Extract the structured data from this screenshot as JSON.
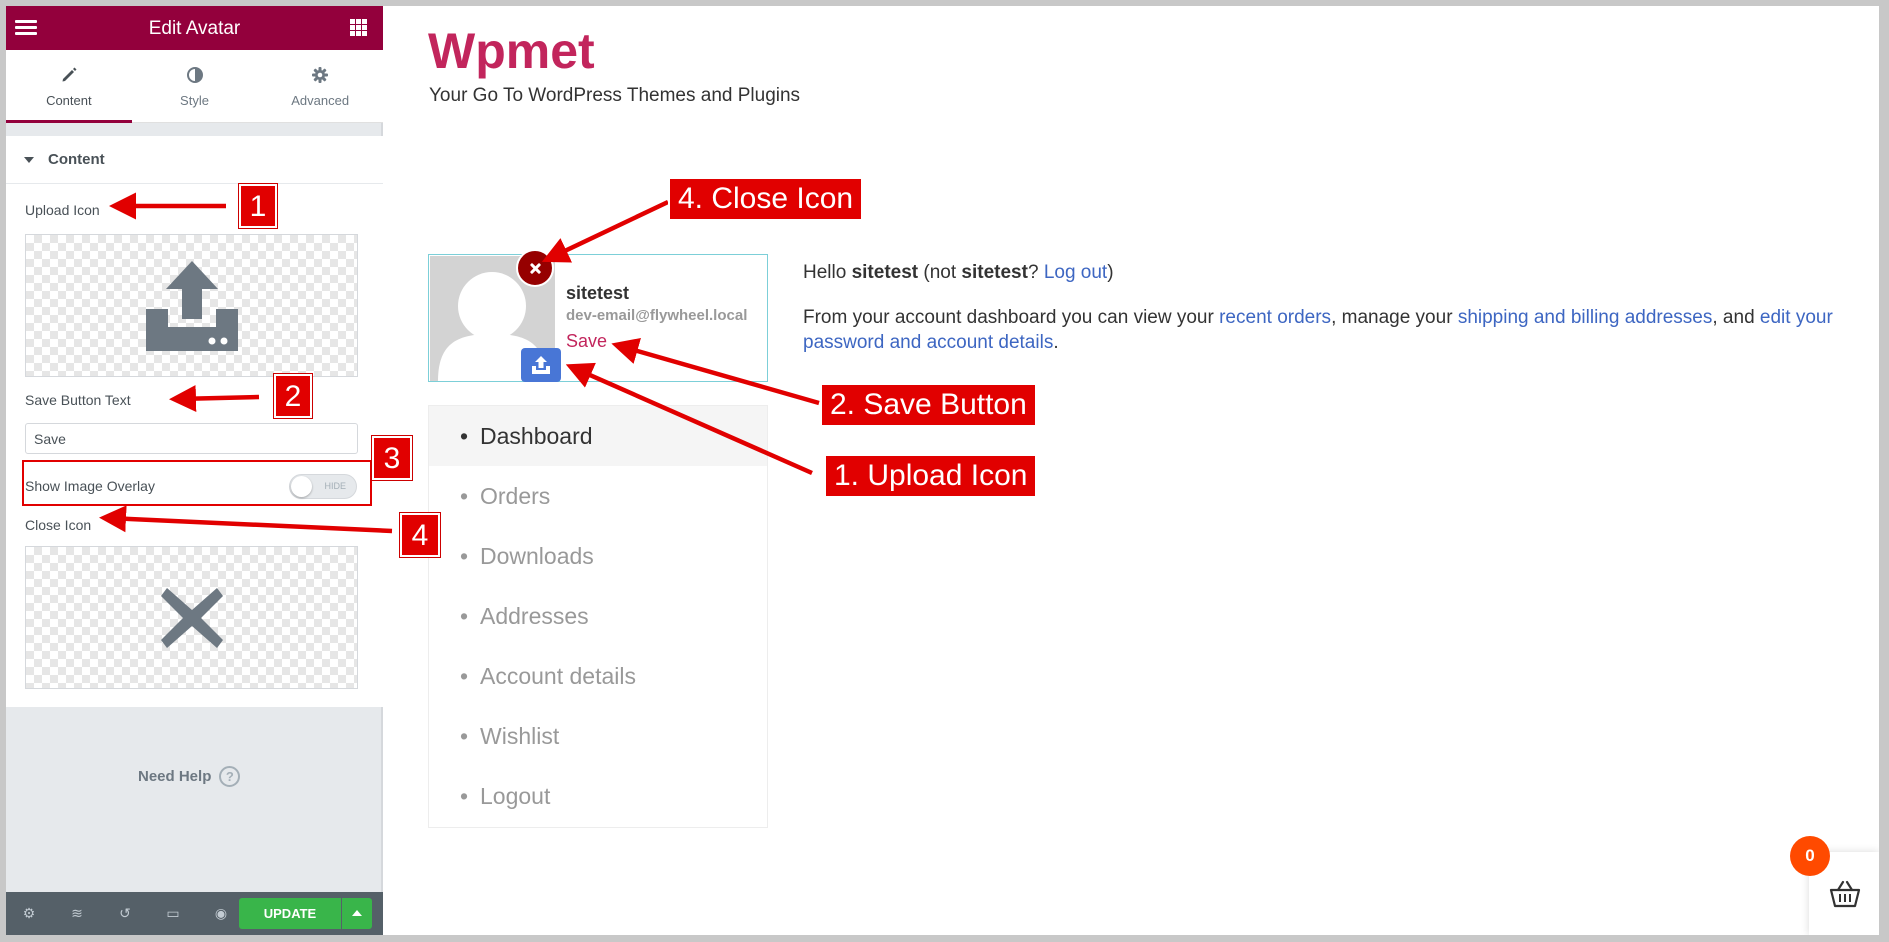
{
  "panel": {
    "title": "Edit Avatar",
    "tabs": [
      {
        "label": "Content",
        "icon": "pencil-icon"
      },
      {
        "label": "Style",
        "icon": "half-circle-icon"
      },
      {
        "label": "Advanced",
        "icon": "gear-icon"
      }
    ],
    "section_title": "Content",
    "upload_icon_label": "Upload Icon",
    "save_button_text_label": "Save Button Text",
    "save_button_text_value": "Save",
    "show_overlay_label": "Show Image Overlay",
    "overlay_toggle_text": "HIDE",
    "close_icon_label": "Close Icon",
    "need_help": "Need Help",
    "help_icon": "?",
    "update_label": "UPDATE"
  },
  "site": {
    "title": "Wpmet",
    "tagline": "Your Go To WordPress Themes and Plugins"
  },
  "avatar": {
    "username": "sitetest",
    "email": "dev-email@flywheel.local",
    "save_label": "Save"
  },
  "account_nav": [
    "Dashboard",
    "Orders",
    "Downloads",
    "Addresses",
    "Account details",
    "Wishlist",
    "Logout"
  ],
  "greeting": {
    "hello": "Hello ",
    "user": "sitetest",
    "not_open": " (not ",
    "user2": "sitetest",
    "q": "? ",
    "logout": "Log out",
    "close": ")"
  },
  "dashboard": {
    "t1": "From your account dashboard you can view your ",
    "l1": "recent orders",
    "t2": ", manage your ",
    "l2": "shipping and billing addresses",
    "t3": ", and ",
    "l3": "edit your password and account details",
    "t4": "."
  },
  "cart": {
    "count": "0"
  },
  "annotations": {
    "n1": "1",
    "n2": "2",
    "n3": "3",
    "n4": "4",
    "close_icon": "4. Close Icon",
    "save_button": "2. Save Button",
    "upload_icon": "1. Upload Icon"
  },
  "colors": {
    "brand": "#93003c",
    "site_title": "#c2255c",
    "link": "#3d66c2",
    "annotation_red": "#e10000",
    "update_green": "#39b54a",
    "upload_blue": "#4876d6",
    "close_red": "#960000",
    "cart_badge": "#ff4a00"
  }
}
